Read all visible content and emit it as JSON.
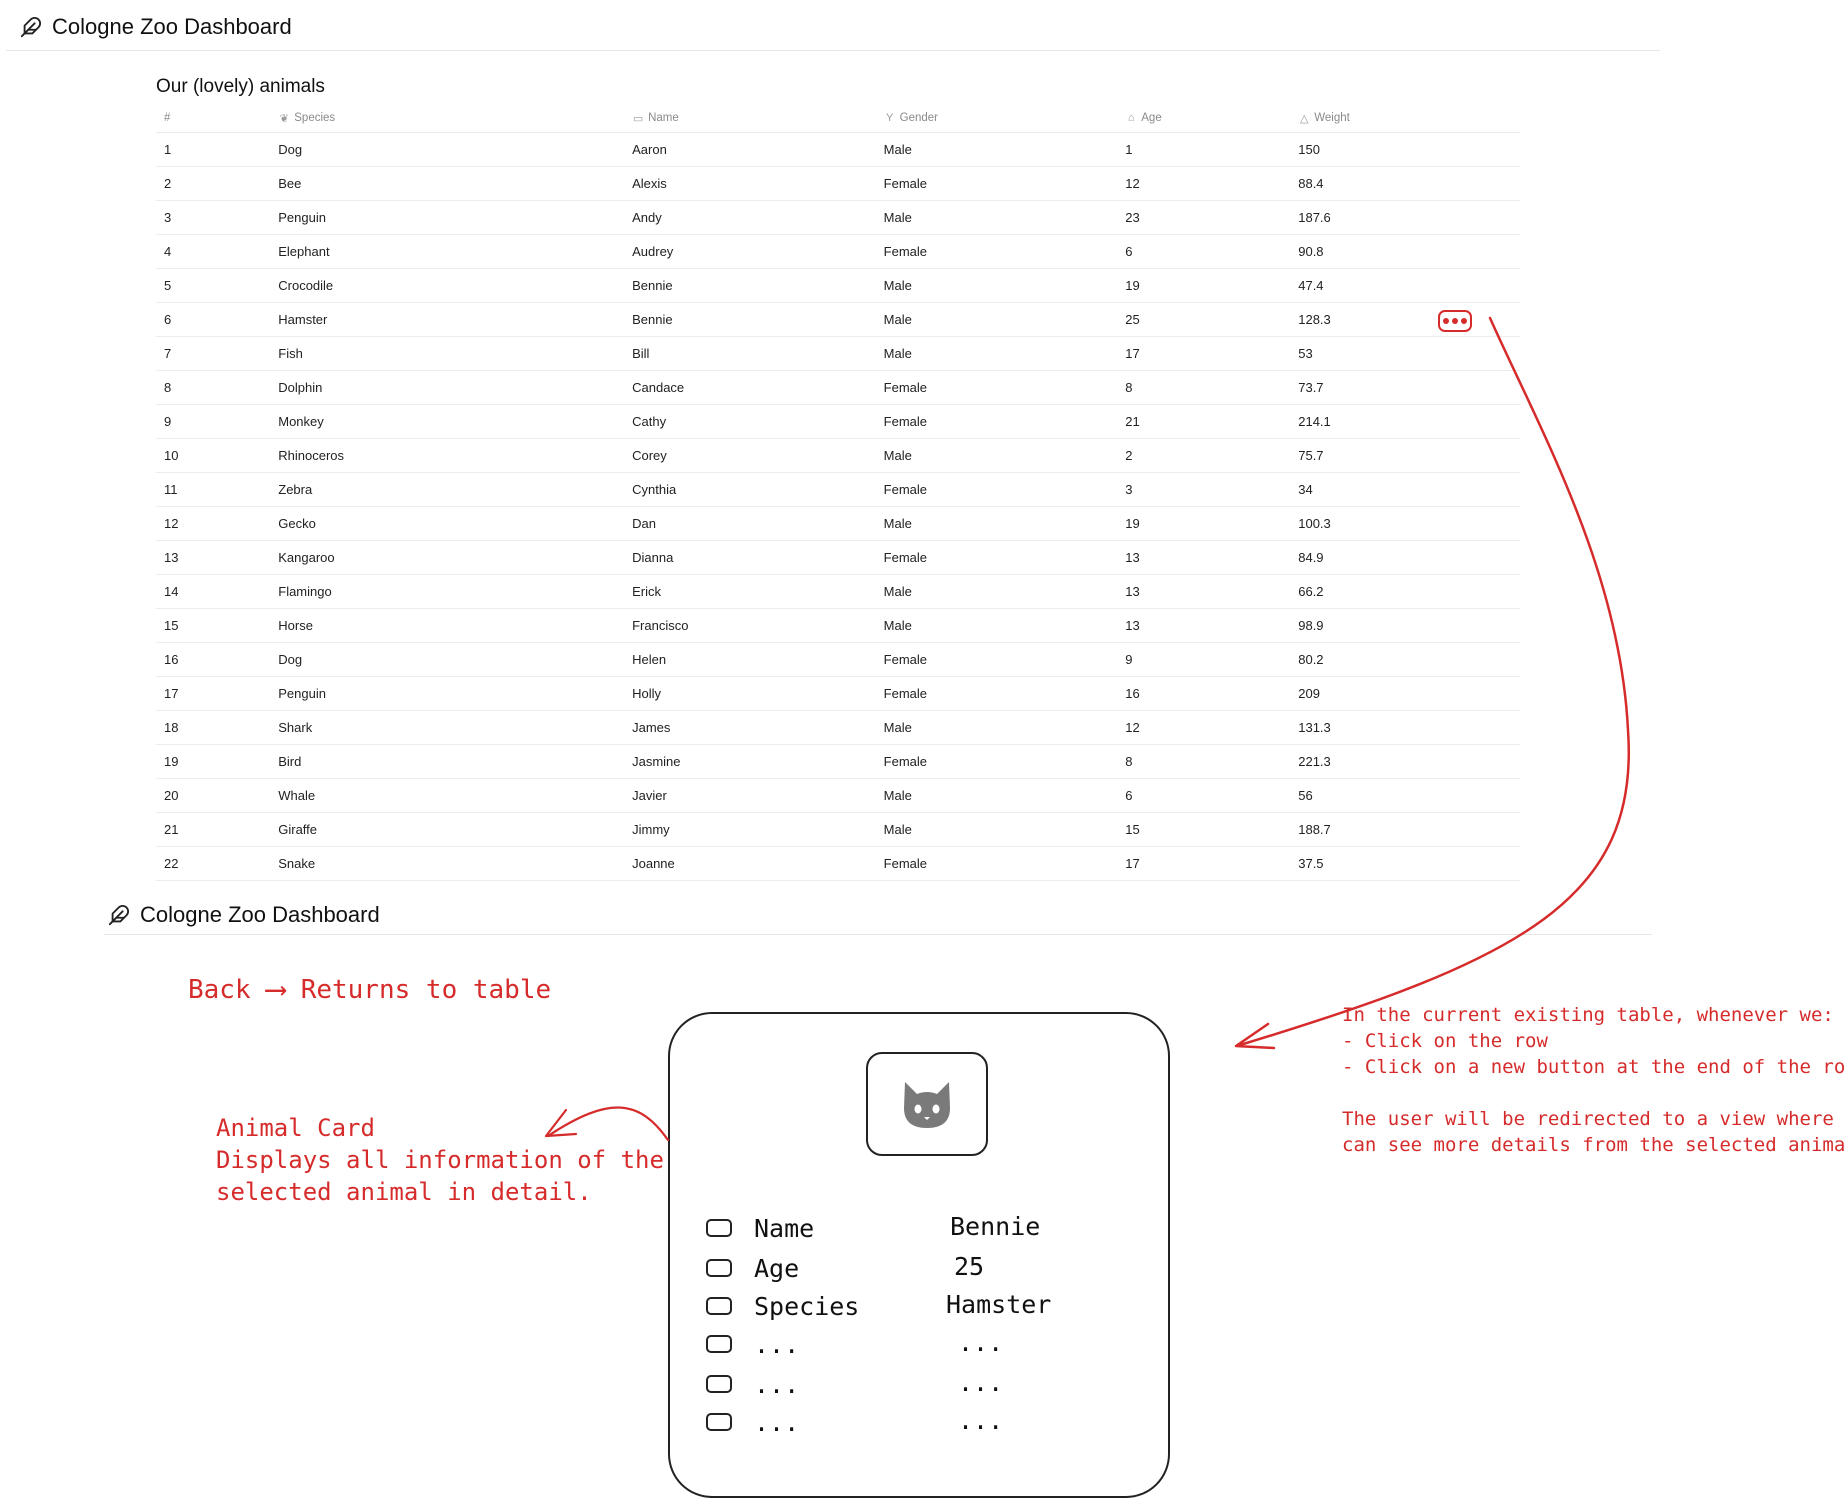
{
  "app": {
    "title": "Cologne Zoo Dashboard",
    "logo_icon": "feather-icon"
  },
  "table": {
    "title": "Our (lovely) animals",
    "columns": {
      "num": {
        "label": "#"
      },
      "species": {
        "label": "Species",
        "icon": "leaf-icon"
      },
      "name": {
        "label": "Name",
        "icon": "id-card-icon"
      },
      "gender": {
        "label": "Gender",
        "icon": "gender-icon"
      },
      "age": {
        "label": "Age",
        "icon": "cake-icon"
      },
      "weight": {
        "label": "Weight",
        "icon": "weight-icon"
      }
    },
    "rows": [
      {
        "num": "1",
        "species": "Dog",
        "name": "Aaron",
        "gender": "Male",
        "age": "1",
        "weight": "150"
      },
      {
        "num": "2",
        "species": "Bee",
        "name": "Alexis",
        "gender": "Female",
        "age": "12",
        "weight": "88.4"
      },
      {
        "num": "3",
        "species": "Penguin",
        "name": "Andy",
        "gender": "Male",
        "age": "23",
        "weight": "187.6"
      },
      {
        "num": "4",
        "species": "Elephant",
        "name": "Audrey",
        "gender": "Female",
        "age": "6",
        "weight": "90.8"
      },
      {
        "num": "5",
        "species": "Crocodile",
        "name": "Bennie",
        "gender": "Male",
        "age": "19",
        "weight": "47.4"
      },
      {
        "num": "6",
        "species": "Hamster",
        "name": "Bennie",
        "gender": "Male",
        "age": "25",
        "weight": "128.3"
      },
      {
        "num": "7",
        "species": "Fish",
        "name": "Bill",
        "gender": "Male",
        "age": "17",
        "weight": "53"
      },
      {
        "num": "8",
        "species": "Dolphin",
        "name": "Candace",
        "gender": "Female",
        "age": "8",
        "weight": "73.7"
      },
      {
        "num": "9",
        "species": "Monkey",
        "name": "Cathy",
        "gender": "Female",
        "age": "21",
        "weight": "214.1"
      },
      {
        "num": "10",
        "species": "Rhinoceros",
        "name": "Corey",
        "gender": "Male",
        "age": "2",
        "weight": "75.7"
      },
      {
        "num": "11",
        "species": "Zebra",
        "name": "Cynthia",
        "gender": "Female",
        "age": "3",
        "weight": "34"
      },
      {
        "num": "12",
        "species": "Gecko",
        "name": "Dan",
        "gender": "Male",
        "age": "19",
        "weight": "100.3"
      },
      {
        "num": "13",
        "species": "Kangaroo",
        "name": "Dianna",
        "gender": "Female",
        "age": "13",
        "weight": "84.9"
      },
      {
        "num": "14",
        "species": "Flamingo",
        "name": "Erick",
        "gender": "Male",
        "age": "13",
        "weight": "66.2"
      },
      {
        "num": "15",
        "species": "Horse",
        "name": "Francisco",
        "gender": "Male",
        "age": "13",
        "weight": "98.9"
      },
      {
        "num": "16",
        "species": "Dog",
        "name": "Helen",
        "gender": "Female",
        "age": "9",
        "weight": "80.2"
      },
      {
        "num": "17",
        "species": "Penguin",
        "name": "Holly",
        "gender": "Female",
        "age": "16",
        "weight": "209"
      },
      {
        "num": "18",
        "species": "Shark",
        "name": "James",
        "gender": "Male",
        "age": "12",
        "weight": "131.3"
      },
      {
        "num": "19",
        "species": "Bird",
        "name": "Jasmine",
        "gender": "Female",
        "age": "8",
        "weight": "221.3"
      },
      {
        "num": "20",
        "species": "Whale",
        "name": "Javier",
        "gender": "Male",
        "age": "6",
        "weight": "56"
      },
      {
        "num": "21",
        "species": "Giraffe",
        "name": "Jimmy",
        "gender": "Male",
        "age": "15",
        "weight": "188.7"
      },
      {
        "num": "22",
        "species": "Snake",
        "name": "Joanne",
        "gender": "Female",
        "age": "17",
        "weight": "37.5"
      }
    ]
  },
  "row_action": {
    "icon": "more-dots-icon"
  },
  "sketch": {
    "back_label": "Back",
    "back_note": "Returns to table",
    "card_note": "Animal Card\nDisplays all information of the\nselected animal in detail.",
    "flow_note": "In the current existing table, whenever we:\n- Click on the row\n- Click on a new button at the end of the row\n\nThe user will be redirected to a view where they\ncan see more details from the selected animal",
    "accent_color": "#d62b2b",
    "card": {
      "avatar_icon": "cat-icon",
      "rows": [
        {
          "label": "Name",
          "value": "Bennie"
        },
        {
          "label": "Age",
          "value": "25"
        },
        {
          "label": "Species",
          "value": "Hamster"
        },
        {
          "label": "...",
          "value": "..."
        },
        {
          "label": "...",
          "value": "..."
        },
        {
          "label": "...",
          "value": "..."
        }
      ]
    }
  }
}
